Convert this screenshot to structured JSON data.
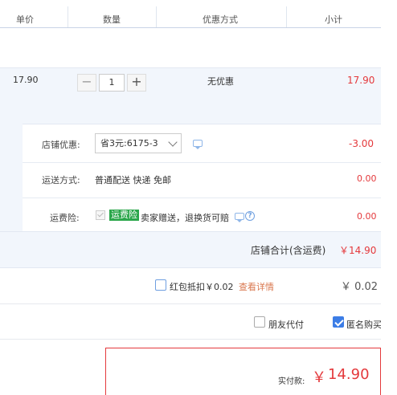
{
  "header": {
    "col_price": "单价",
    "col_qty": "数量",
    "col_discount": "优惠方式",
    "col_subtotal": "小计"
  },
  "item": {
    "price": "17.90",
    "quantity": "1",
    "minus": "−",
    "plus": "+",
    "discount": "无优惠",
    "subtotal": "17.90"
  },
  "promo": {
    "shop_discount_label": "店铺优惠:",
    "shop_discount_selected": "省3元:6175-3",
    "shop_discount_amount": "-3.00",
    "shipping_label": "运送方式:",
    "shipping_value": "普通配送 快递 免邮",
    "shipping_amount": "0.00",
    "insurance_label": "运费险:",
    "insurance_badge": "运费险",
    "insurance_text": "卖家赠送，退换货可赔",
    "insurance_amount": "0.00"
  },
  "shop_total": {
    "label": "店铺合计(含运费)",
    "amount": "￥14.90"
  },
  "red_packet": {
    "label": "红包抵扣￥0.02",
    "link": "查看详情",
    "amount": "￥ 0.02"
  },
  "options": {
    "friend_pay": "朋友代付",
    "anonymous": "匿名购买"
  },
  "payment": {
    "label": "实付款:",
    "currency": "￥",
    "amount": "14.90"
  },
  "colors": {
    "accent_red": "#e4393c",
    "light_blue_bg": "#f2f6fc",
    "checkbox_blue": "#3c7de6",
    "badge_green": "#2aa64a"
  }
}
